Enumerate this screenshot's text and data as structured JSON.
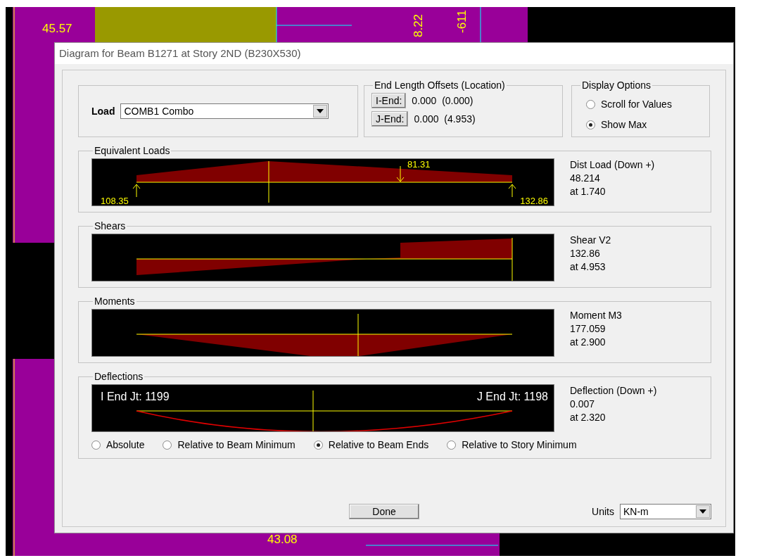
{
  "model_view": {
    "labels": [
      {
        "text": "45.57",
        "rotated": false
      },
      {
        "text": "8.22",
        "rotated": true
      },
      {
        "text": "-611",
        "rotated": true
      },
      {
        "text": "43.08",
        "rotated": false
      }
    ]
  },
  "dialog": {
    "title": "Diagram for Beam B1271 at Story 2ND (B230X530)",
    "load": {
      "label": "Load",
      "value": "COMB1 Combo"
    },
    "end_offsets": {
      "title": "End Length Offsets (Location)",
      "rows": [
        {
          "button": "I-End:",
          "value": "0.000  (0.000)"
        },
        {
          "button": "J-End:",
          "value": "0.000  (4.953)"
        }
      ]
    },
    "display_options": {
      "title": "Display Options",
      "options": [
        {
          "label": "Scroll for Values",
          "selected": false
        },
        {
          "label": "Show Max",
          "selected": true
        }
      ]
    },
    "panels": [
      {
        "kind": "load",
        "title": "Equivalent Loads",
        "labels": [
          "108.35",
          "81.31",
          "132.86"
        ],
        "readout": [
          "Dist Load (Down +)",
          "48.214",
          "at 1.740"
        ]
      },
      {
        "kind": "shear",
        "title": "Shears",
        "readout": [
          "Shear V2",
          "132.86",
          "at 4.953"
        ]
      },
      {
        "kind": "moment",
        "title": "Moments",
        "readout": [
          "Moment M3",
          "177.059",
          "at 2.900"
        ]
      },
      {
        "kind": "deflection",
        "title": "Deflections",
        "labels": [
          "I End Jt: 1199",
          "J End Jt: 1198"
        ],
        "readout": [
          "Deflection (Down +)",
          "0.007",
          "at 2.320"
        ],
        "options": [
          {
            "label": "Absolute",
            "selected": false
          },
          {
            "label": "Relative to Beam Minimum",
            "selected": false
          },
          {
            "label": "Relative to Beam Ends",
            "selected": true
          },
          {
            "label": "Relative to Story Minimum",
            "selected": false
          }
        ]
      }
    ],
    "done": "Done",
    "units": {
      "label": "Units",
      "value": "KN-m"
    }
  }
}
